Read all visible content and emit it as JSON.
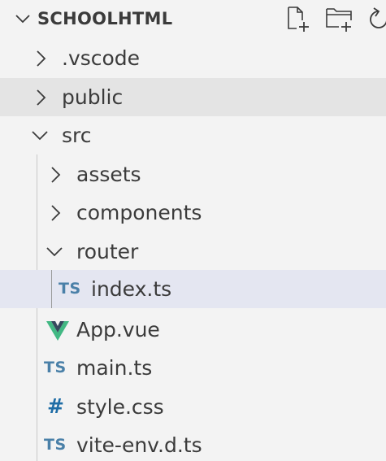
{
  "explorer": {
    "section_title": "SCHOOLHTML",
    "actions": {
      "new_file_icon": "new-file-icon",
      "new_folder_icon": "new-folder-icon",
      "refresh_icon": "refresh-icon"
    }
  },
  "tree": {
    "vscode_folder": ".vscode",
    "public_folder": "public",
    "src_folder": "src",
    "assets_folder": "assets",
    "components_folder": "components",
    "router_folder": "router",
    "index_file": "index.ts",
    "app_file": "App.vue",
    "main_file": "main.ts",
    "style_file": "style.css",
    "vite_env_file": "vite-env.d.ts"
  },
  "file_badges": {
    "ts": "TS",
    "css": "#"
  },
  "colors": {
    "background": "#f3f3f3",
    "hover_row": "#e4e4e4",
    "selected_row": "#e4e6f1",
    "ts_icon": "#4a80a8",
    "css_icon": "#1f6da6",
    "vue_icon_outer": "#41b883",
    "vue_icon_inner": "#35495e"
  }
}
